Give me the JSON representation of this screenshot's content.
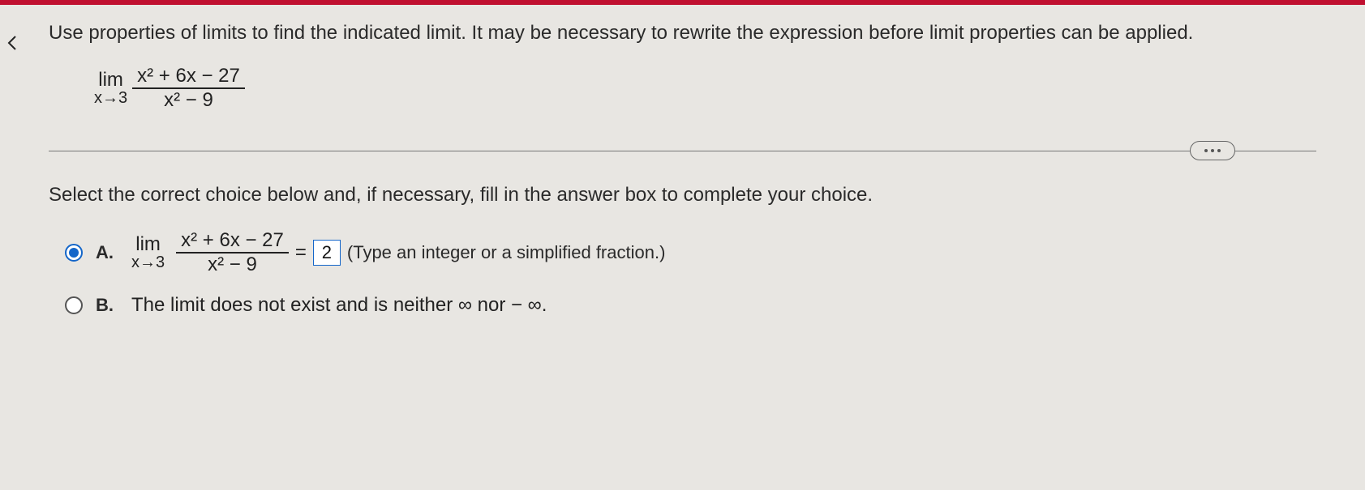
{
  "topbar": {
    "color": "#c01030"
  },
  "instruction": "Use properties of limits to find the indicated limit. It may be necessary to rewrite the expression before limit properties can be applied.",
  "problem": {
    "lim_label": "lim",
    "approach": "x→3",
    "numerator": "x² + 6x − 27",
    "denominator": "x² − 9"
  },
  "prompt2": "Select the correct choice below and, if necessary, fill in the answer box to complete your choice.",
  "choices": {
    "A": {
      "label": "A.",
      "selected": true,
      "lim_label": "lim",
      "approach": "x→3",
      "numerator": "x² + 6x − 27",
      "denominator": "x² − 9",
      "equals": "=",
      "answer_value": "2",
      "hint": "(Type an integer or a simplified fraction.)"
    },
    "B": {
      "label": "B.",
      "selected": false,
      "text": "The limit does not exist and is neither ∞ nor − ∞."
    }
  }
}
